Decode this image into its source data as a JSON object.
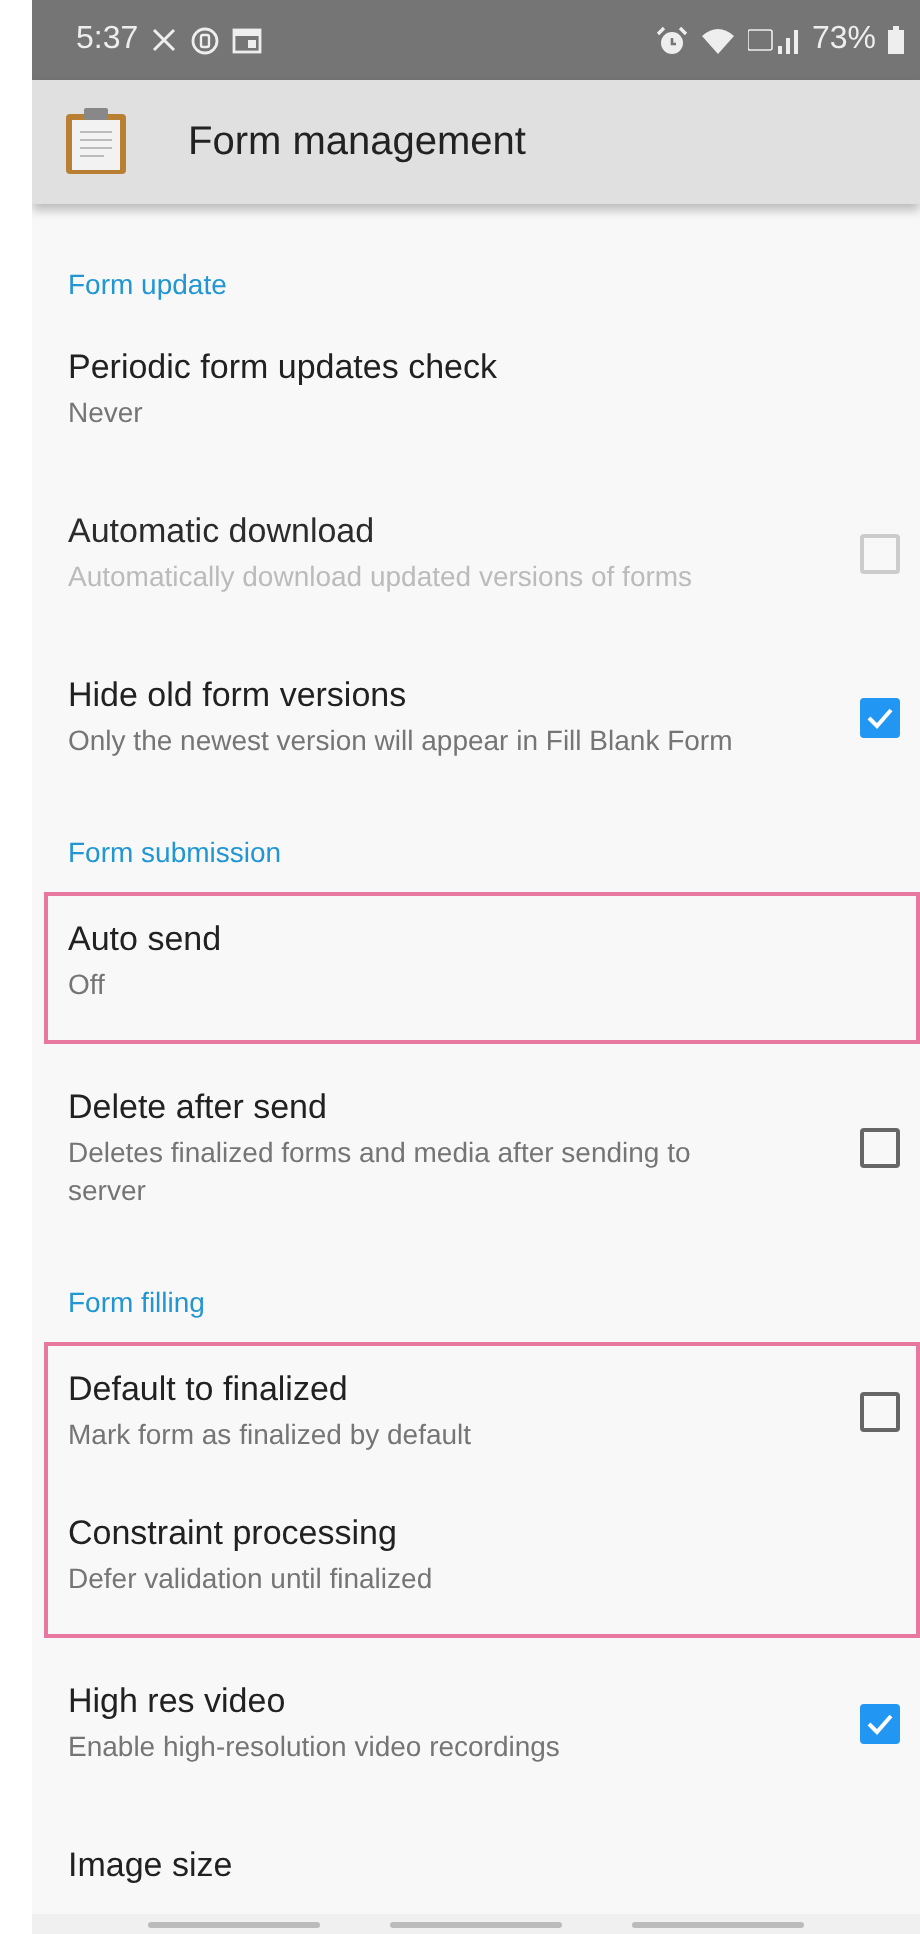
{
  "status_bar": {
    "time": "5:37",
    "battery": "73%"
  },
  "app_bar": {
    "title": "Form management"
  },
  "sections": [
    {
      "title": "Form update",
      "items": [
        {
          "kind": "text",
          "title": "Periodic form updates check",
          "summary": "Never",
          "highlighted": false
        },
        {
          "kind": "checkbox",
          "title": "Automatic download",
          "summary": "Automatically download updated versions of forms",
          "checked": false,
          "disabled": true,
          "highlighted": false
        },
        {
          "kind": "checkbox",
          "title": "Hide old form versions",
          "summary": "Only the newest version will appear in Fill Blank Form",
          "checked": true,
          "disabled": false,
          "highlighted": false
        }
      ]
    },
    {
      "title": "Form submission",
      "items": [
        {
          "kind": "text",
          "title": "Auto send",
          "summary": "Off",
          "highlighted": true
        },
        {
          "kind": "checkbox",
          "title": "Delete after send",
          "summary": "Deletes finalized forms and media after sending to server",
          "checked": false,
          "disabled": false,
          "highlighted": false
        }
      ]
    },
    {
      "title": "Form filling",
      "items": [
        {
          "kind": "checkbox",
          "title": "Default to finalized",
          "summary": "Mark form as finalized by default",
          "checked": false,
          "disabled": false,
          "highlighted": true
        },
        {
          "kind": "text",
          "title": "Constraint processing",
          "summary": "Defer validation until finalized",
          "highlighted": true
        },
        {
          "kind": "checkbox",
          "title": "High res video",
          "summary": "Enable high-resolution video recordings",
          "checked": true,
          "disabled": false,
          "highlighted": false
        },
        {
          "kind": "text",
          "title": "Image size",
          "highlighted": false
        }
      ]
    }
  ]
}
